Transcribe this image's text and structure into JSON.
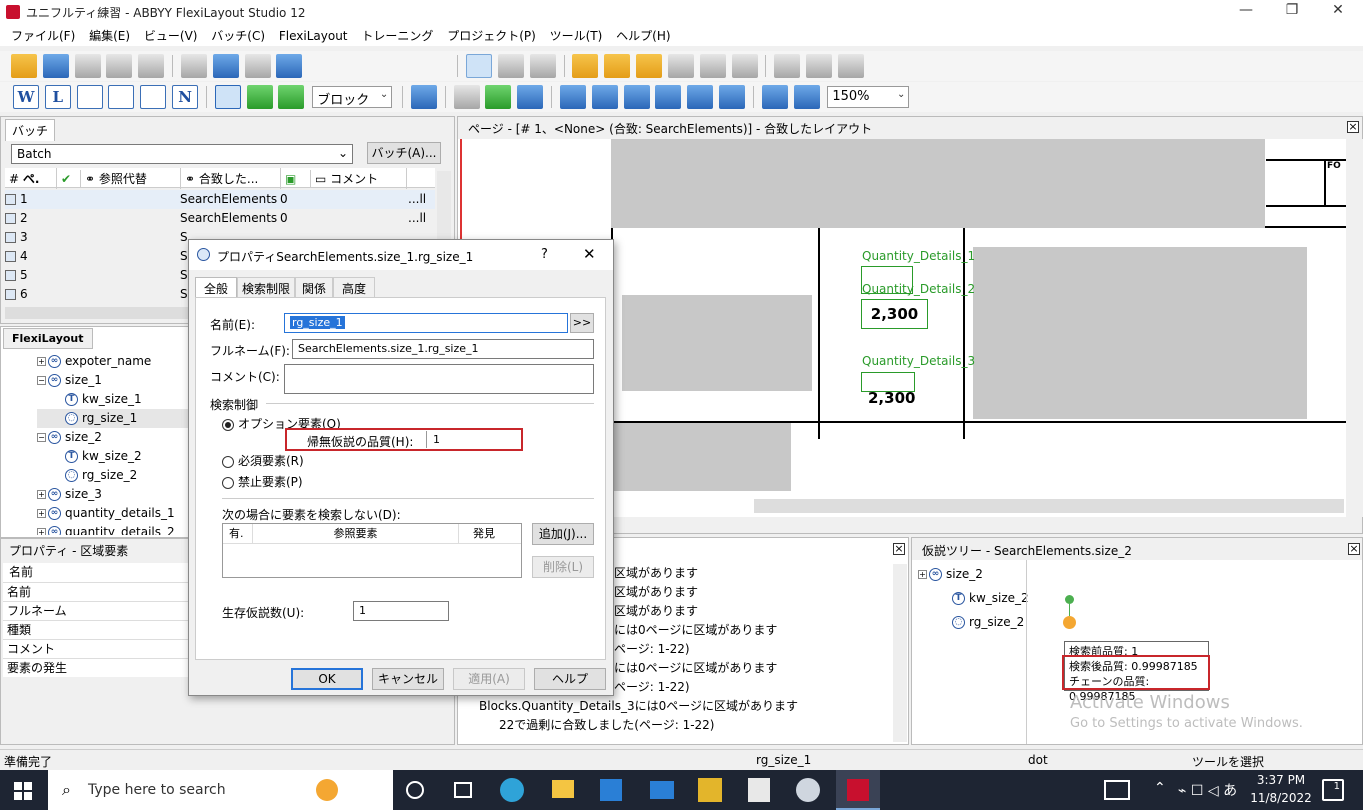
{
  "window": {
    "title": "ユニフルティ練習 - ABBYY FlexiLayout Studio 12",
    "minimize": "—",
    "maximize": "❐",
    "close": "✕"
  },
  "menu": [
    "ファイル(F)",
    "編集(E)",
    "ビュー(V)",
    "バッチ(C)",
    "FlexiLayout",
    "トレーニング",
    "プロジェクト(P)",
    "ツール(T)",
    "ヘルプ(H)"
  ],
  "toolbar": {
    "letters": [
      "W",
      "L",
      "N"
    ],
    "block_combo": "ブロック",
    "zoom_combo": "150%"
  },
  "batch_panel": {
    "tab": "バッチ",
    "combo_value": "Batch",
    "button": "バッチ(A)...",
    "headers": [
      "ペ.",
      "参照代替",
      "合致した...",
      "コメント"
    ],
    "rows": [
      {
        "num": "1",
        "elem": "SearchElements",
        "val": "0",
        "tail": "...ll"
      },
      {
        "num": "2",
        "elem": "SearchElements",
        "val": "0",
        "tail": "...ll"
      },
      {
        "num": "3",
        "elem": "S",
        "val": "",
        "tail": ""
      },
      {
        "num": "4",
        "elem": "S",
        "val": "",
        "tail": ""
      },
      {
        "num": "5",
        "elem": "S",
        "val": "",
        "tail": ""
      },
      {
        "num": "6",
        "elem": "S",
        "val": "",
        "tail": ""
      }
    ]
  },
  "flexilayout_panel": {
    "tab": "FlexiLayout",
    "tree": [
      {
        "label": "expoter_name",
        "level": 1,
        "pm": "+"
      },
      {
        "label": "size_1",
        "level": 1,
        "pm": "−"
      },
      {
        "label": "kw_size_1",
        "level": 2,
        "pm": ""
      },
      {
        "label": "rg_size_1",
        "level": 2,
        "pm": ""
      },
      {
        "label": "size_2",
        "level": 1,
        "pm": "−"
      },
      {
        "label": "kw_size_2",
        "level": 2,
        "pm": ""
      },
      {
        "label": "rg_size_2",
        "level": 2,
        "pm": ""
      },
      {
        "label": "size_3",
        "level": 1,
        "pm": "+"
      },
      {
        "label": "quantity_details_1",
        "level": 1,
        "pm": "+"
      },
      {
        "label": "quantity_details_2",
        "level": 1,
        "pm": "+"
      }
    ]
  },
  "properties_panel": {
    "title": "プロパティ - 区域要素",
    "rows": [
      "名前",
      "名前",
      "フルネーム",
      "種類",
      "コメント",
      "要素の発生"
    ]
  },
  "page_panel": {
    "title": "ページ - [# 1、<None> (合致: SearchElements)] - 合致したレイアウト",
    "labels": [
      "Quantity_Details_1",
      "Quantity_Details_2",
      "Quantity_Details_3"
    ],
    "values": [
      "2,300",
      "2,300"
    ],
    "corner_text": "FO"
  },
  "messages_panel": {
    "lines": [
      "区域があります",
      "区域があります",
      "区域があります",
      "には0ページに区域があります",
      "ページ: 1-22)",
      "には0ページに区域があります",
      "ページ: 1-22)",
      "Blocks.Quantity_Details_3には0ページに区域があります",
      "22で過剰に合致しました(ページ: 1-22)"
    ]
  },
  "hypothesis_panel": {
    "title": "仮説ツリー - SearchElements.size_2",
    "tree": [
      "size_2",
      "kw_size_2",
      "rg_size_2"
    ],
    "tooltip": [
      "検索前品質: 1",
      "検索後品質: 0.99987185",
      "チェーンの品質: 0.99987185"
    ],
    "watermark1": "Activate Windows",
    "watermark2": "Go to Settings to activate Windows."
  },
  "dialog": {
    "title": "プロパティSearchElements.size_1.rg_size_1",
    "help": "?",
    "tabs": [
      "全般",
      "検索制限",
      "関係",
      "高度"
    ],
    "name_label": "名前(E):",
    "name_value": "rg_size_1",
    "name_btn": ">>",
    "fullname_label": "フルネーム(F):",
    "fullname_value": "SearchElements.size_1.rg_size_1",
    "comment_label": "コメント(C):",
    "search_control": "検索制御",
    "opt_optional": "オプション要素(O)",
    "quality_label": "帰無仮説の品質(H):",
    "quality_value": "1",
    "opt_required": "必須要素(R)",
    "opt_forbidden": "禁止要素(P)",
    "no_search_label": "次の場合に要素を検索しない(D):",
    "cols": [
      "有.",
      "参照要素",
      "発見"
    ],
    "add_btn": "追加(J)...",
    "del_btn": "削除(L)",
    "survive_label": "生存仮説数(U):",
    "survive_value": "1",
    "ok": "OK",
    "cancel": "キャンセル",
    "apply": "適用(A)",
    "helpbtn": "ヘルプ"
  },
  "statusbar": {
    "left": "準備完了",
    "mid": "rg_size_1",
    "dot": "dot",
    "right": "ツールを選択"
  },
  "taskbar": {
    "search": "Type here to search",
    "time": "3:37 PM",
    "date": "11/8/2022",
    "notif": "1"
  }
}
